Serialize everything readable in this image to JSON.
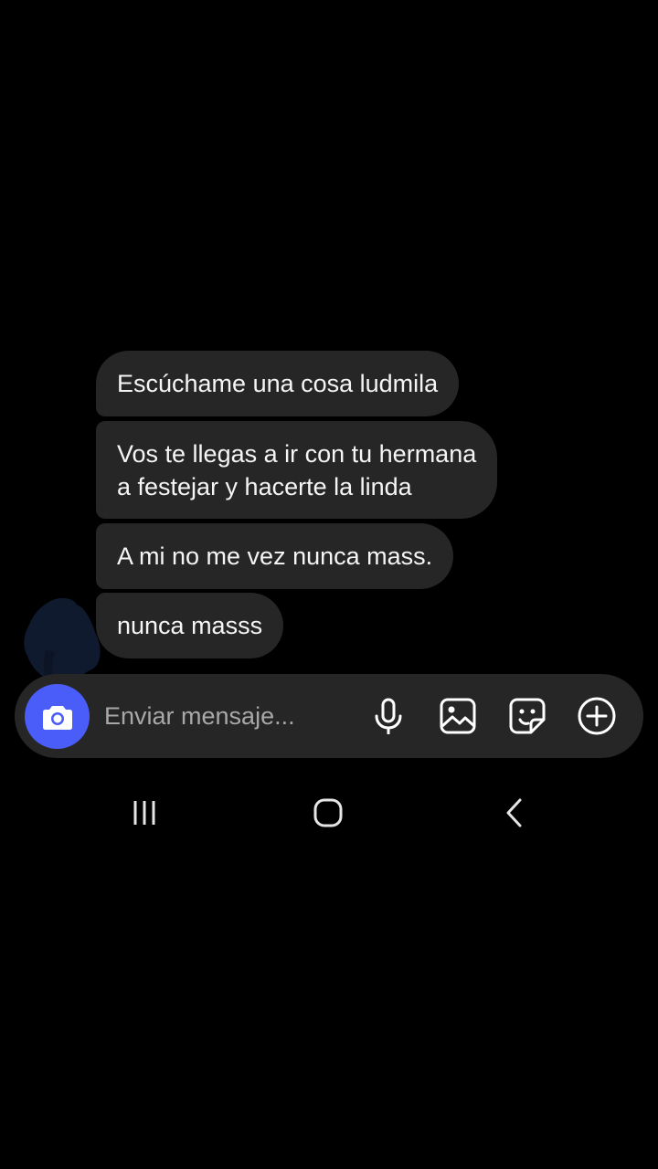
{
  "messages": [
    {
      "text": "Escúchame una cosa ludmila"
    },
    {
      "text": "Vos te llegas a ir con tu hermana\na festejar y hacerte la linda"
    },
    {
      "text": "A mi no me vez nunca mass."
    },
    {
      "text": "nunca masss"
    }
  ],
  "composer": {
    "placeholder": "Enviar mensaje...",
    "camera_icon": "camera-icon",
    "accent_color": "#4a5df9",
    "tools": [
      "microphone-icon",
      "gallery-icon",
      "sticker-icon",
      "plus-circle-icon"
    ]
  },
  "navigation": {
    "buttons": [
      "recent-apps-icon",
      "home-icon",
      "back-icon"
    ]
  },
  "colors": {
    "background": "#000000",
    "bubble": "#262626",
    "text": "#f5f5f5",
    "placeholder": "#a8a8a8",
    "avatar_redaction": "#0f1a2e"
  }
}
